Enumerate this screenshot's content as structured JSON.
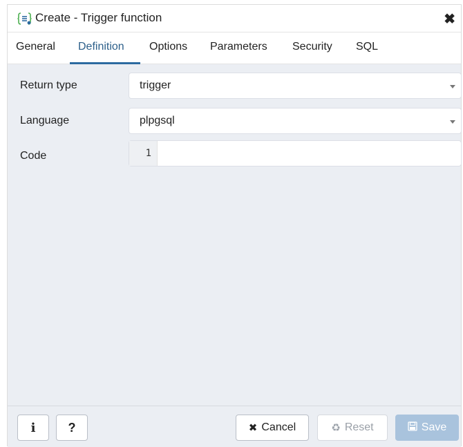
{
  "window": {
    "title": "Create - Trigger function",
    "close_glyph": "✖"
  },
  "tabs": [
    {
      "label": "General",
      "active": false
    },
    {
      "label": "Definition",
      "active": true
    },
    {
      "label": "Options",
      "active": false
    },
    {
      "label": "Parameters",
      "active": false
    },
    {
      "label": "Security",
      "active": false
    },
    {
      "label": "SQL",
      "active": false
    }
  ],
  "form": {
    "return_type": {
      "label": "Return type",
      "value": "trigger"
    },
    "language": {
      "label": "Language",
      "value": "plpgsql"
    },
    "code": {
      "label": "Code",
      "line_number": "1",
      "value": ""
    }
  },
  "footer": {
    "info_label": "i",
    "help_label": "?",
    "cancel_label": "Cancel",
    "reset_label": "Reset",
    "save_label": "Save"
  },
  "colors": {
    "accent": "#2c6aa0",
    "content_bg": "#ebeef3",
    "save_bg": "#a9c3dd"
  },
  "icons": {
    "title": "function-braces-icon",
    "close": "close-icon",
    "cancel": "x-icon",
    "reset": "recycle-icon",
    "save": "floppy-disk-icon",
    "select_caret": "caret-down-icon"
  }
}
